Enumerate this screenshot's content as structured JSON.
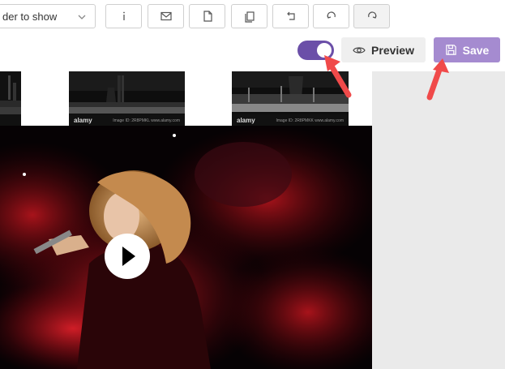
{
  "toolbar": {
    "folder_select_text": "der to show",
    "buttons": [
      "info-icon",
      "mail-icon",
      "file-icon",
      "copy-icon",
      "undo-icon",
      "redo-icon",
      "refresh-icon"
    ]
  },
  "actions": {
    "toggle_state": "on",
    "preview_label": "Preview",
    "save_label": "Save"
  },
  "thumbnails": [
    {
      "logo": "",
      "meta": ""
    },
    {
      "logo": "alamy",
      "meta": "Image ID: 2R8PMKL\nwww.alamy.com"
    },
    {
      "logo": "alamy",
      "meta": "Image ID: 2R8PMKK\nwww.alamy.com"
    }
  ],
  "colors": {
    "accent": "#6b4fa8",
    "save_bg": "#a58bd0",
    "annotation_arrow": "#f04a4a"
  }
}
